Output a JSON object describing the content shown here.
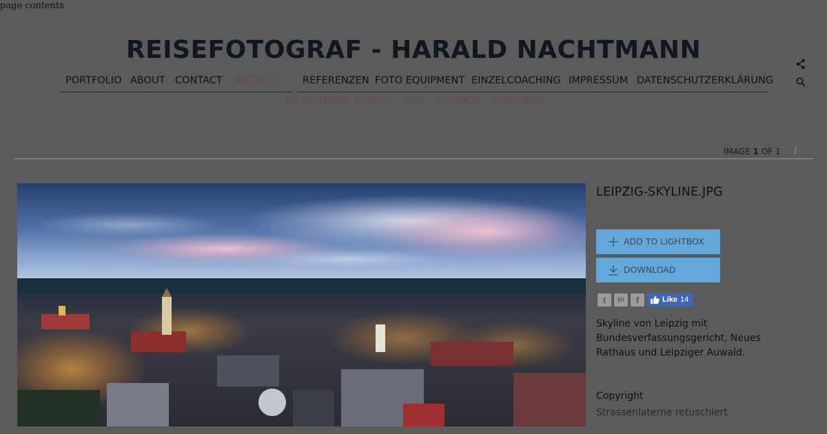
{
  "skip_link": "page contents",
  "site_title": "REISEFOTOGRAF - HARALD NACHTMANN",
  "nav": {
    "items": [
      {
        "label": "PORTFOLIO"
      },
      {
        "label": "ABOUT"
      },
      {
        "label": "CONTACT"
      },
      {
        "label": "ARCHIVE",
        "active": true,
        "suffix": "—"
      },
      {
        "label": "REFERENZEN"
      },
      {
        "label": "FOTO EQUIPMENT"
      },
      {
        "label": "EINZELCOACHING"
      },
      {
        "label": "IMPRESSUM"
      },
      {
        "label": "DATENSCHUTZERKLÄRUNG"
      }
    ],
    "subitems": [
      {
        "label": "ALL GALLERIES"
      },
      {
        "label": "SEARCH"
      },
      {
        "label": "CART"
      },
      {
        "label": "LIGHTBOX"
      },
      {
        "label": "CLIENT AREA"
      }
    ]
  },
  "header_icons": [
    "share-icon",
    "search-icon"
  ],
  "counter": {
    "prefix": "IMAGE",
    "current": "1",
    "separator": "OF",
    "total": "1"
  },
  "info_icon": "i",
  "image": {
    "filename": "LEIPZIG-SKYLINE.JPG"
  },
  "actions": {
    "lightbox_label": "ADD TO LIGHTBOX",
    "download_label": "DOWNLOAD"
  },
  "social": {
    "twitter": "t",
    "linkedin": "in",
    "facebook": "f",
    "like_label": "Like",
    "like_count": "14"
  },
  "caption": "Skyline von Leipzig mit Bundesverfassungsgericht, Neues Rathaus und Leipziger Auwald.",
  "copyright": {
    "label": "Copyright",
    "value": "Strassenlaterne retuschiert"
  },
  "colors": {
    "overlay_bg": "#5b5b5b",
    "button": "#64a7da",
    "accent_nav": "#6d4848",
    "info": "#5a9fd4",
    "facebook": "#4267b2"
  }
}
